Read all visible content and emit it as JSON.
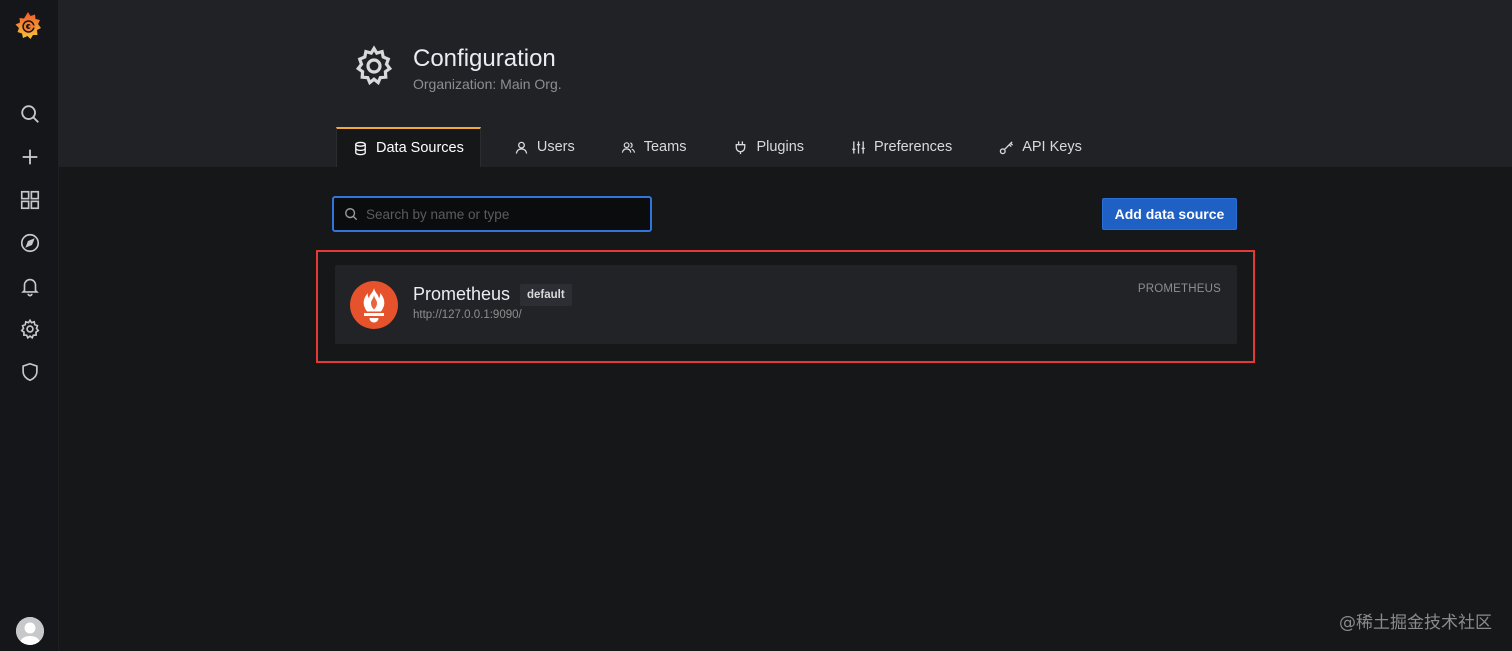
{
  "sidebar": {
    "logo": "grafana-logo-icon",
    "items": [
      {
        "icon": "search-icon",
        "name": "Search"
      },
      {
        "icon": "plus-icon",
        "name": "Create"
      },
      {
        "icon": "dashboards-grid-icon",
        "name": "Dashboards"
      },
      {
        "icon": "compass-icon",
        "name": "Explore"
      },
      {
        "icon": "bell-icon",
        "name": "Alerting"
      },
      {
        "icon": "gear-icon",
        "name": "Configuration"
      },
      {
        "icon": "shield-icon",
        "name": "Server Admin"
      }
    ],
    "avatar": "avatar-icon"
  },
  "header": {
    "title": "Configuration",
    "subtitle": "Organization: Main Org."
  },
  "tabs": [
    {
      "label": "Data Sources",
      "icon": "database-icon",
      "active": true
    },
    {
      "label": "Users",
      "icon": "user-icon",
      "active": false
    },
    {
      "label": "Teams",
      "icon": "users-icon",
      "active": false
    },
    {
      "label": "Plugins",
      "icon": "plug-icon",
      "active": false
    },
    {
      "label": "Preferences",
      "icon": "sliders-icon",
      "active": false
    },
    {
      "label": "API Keys",
      "icon": "key-icon",
      "active": false
    }
  ],
  "toolbar": {
    "search_placeholder": "Search by name or type",
    "search_value": "",
    "add_label": "Add data source"
  },
  "datasources": [
    {
      "name": "Prometheus",
      "badge": "default",
      "url": "http://127.0.0.1:9090/",
      "type": "PROMETHEUS",
      "logo": "prometheus-logo-icon"
    }
  ],
  "watermark": "@稀土掘金技术社区",
  "colors": {
    "accent": "#f2a93b",
    "primary_button": "#1f60c4",
    "highlight_border": "#e53935",
    "prometheus": "#e6522c"
  }
}
